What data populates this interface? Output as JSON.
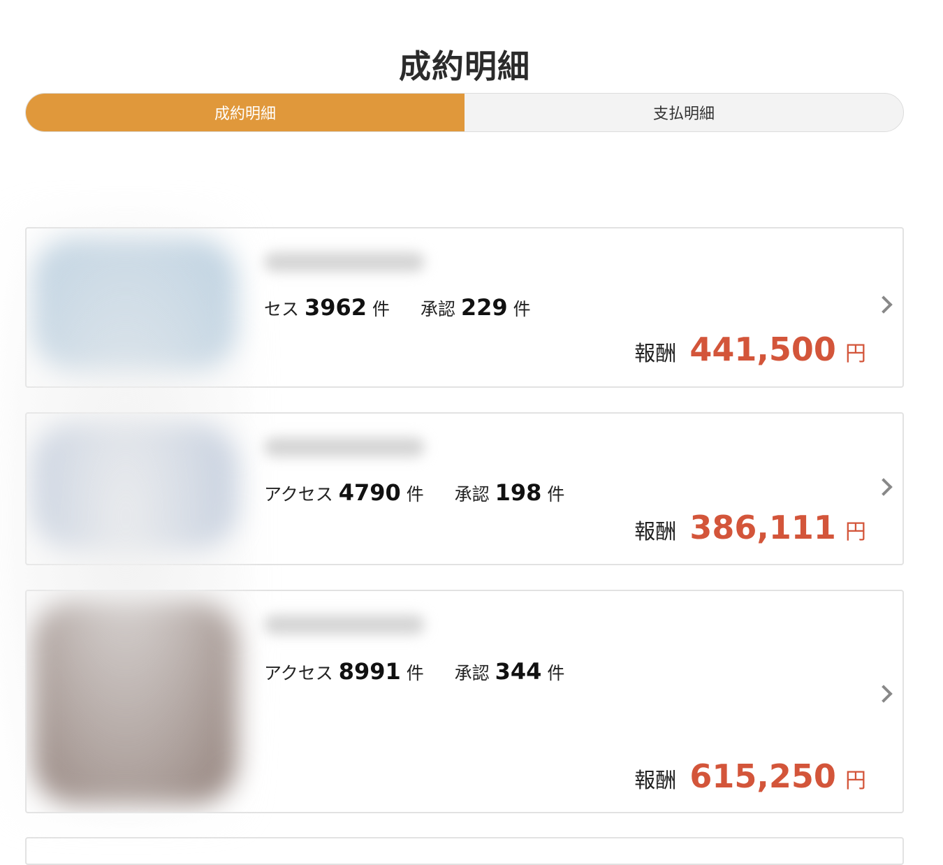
{
  "page": {
    "title": "成約明細"
  },
  "tabs": [
    {
      "label": "成約明細",
      "active": true
    },
    {
      "label": "支払明細",
      "active": false
    }
  ],
  "labels": {
    "access": "アクセス",
    "approve": "承認",
    "count_unit": "件",
    "reward": "報酬",
    "currency": "円"
  },
  "cards": [
    {
      "access_visible": "セス",
      "access_count": "3962",
      "approved_count": "229",
      "reward": "441,500",
      "thumb_color": "#b9cfe0"
    },
    {
      "access_visible": "アクセス",
      "access_count": "4790",
      "approved_count": "198",
      "reward": "386,111",
      "thumb_color": "#b5c3d8"
    },
    {
      "access_visible": "アクセス",
      "access_count": "8991",
      "approved_count": "344",
      "reward": "615,250",
      "thumb_color": "#8a7770"
    }
  ],
  "colors": {
    "accent": "#e0983b",
    "reward": "#d3553a"
  },
  "icons": {
    "card_action": "chevron-right-icon"
  }
}
